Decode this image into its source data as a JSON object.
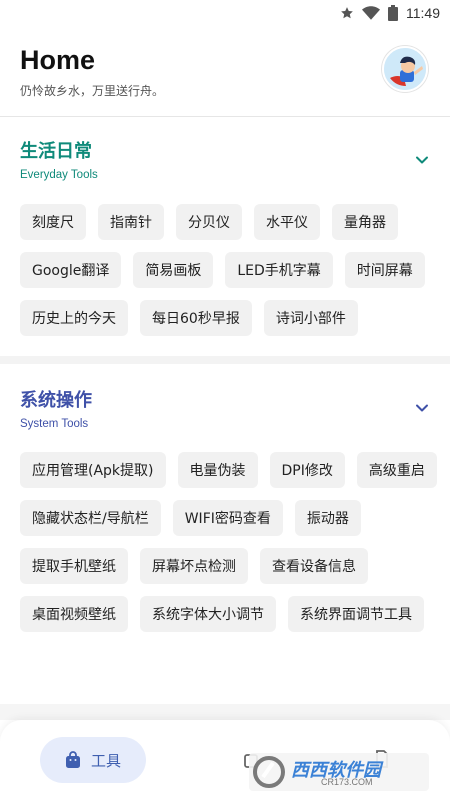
{
  "status_bar": {
    "time": "11:49",
    "icons": [
      "star-icon",
      "wifi-icon",
      "battery-icon"
    ]
  },
  "header": {
    "title": "Home",
    "subtitle": "仍怜故乡水，万里送行舟。"
  },
  "sections": [
    {
      "title": "生活日常",
      "subtitle": "Everyday Tools",
      "color": "#0f8a7a",
      "items": [
        "刻度尺",
        "指南针",
        "分贝仪",
        "水平仪",
        "量角器",
        "Google翻译",
        "简易画板",
        "LED手机字幕",
        "时间屏幕",
        "历史上的今天",
        "每日60秒早报",
        "诗词小部件"
      ]
    },
    {
      "title": "系统操作",
      "subtitle": "System Tools",
      "color": "#3f51a8",
      "items": [
        "应用管理(Apk提取)",
        "电量伪装",
        "DPI修改",
        "高级重启",
        "隐藏状态栏/导航栏",
        "WIFI密码查看",
        "振动器",
        "提取手机壁纸",
        "屏幕坏点检测",
        "查看设备信息",
        "桌面视频壁纸",
        "系统字体大小调节",
        "系统界面调节工具"
      ]
    }
  ],
  "bottom_nav": {
    "tools_label": "工具",
    "tools_color": "#3f5fb0"
  },
  "watermark": {
    "text": "西西软件园",
    "subtext": "CR173.COM"
  }
}
